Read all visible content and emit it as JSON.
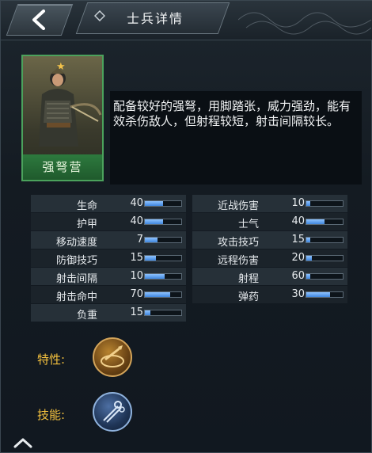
{
  "header": {
    "title": "士兵详情",
    "back_icon": "chevron-left-icon"
  },
  "unit": {
    "name": "强弩营",
    "stars": "★",
    "description": "配备较好的强弩，用脚踏张，威力强劲，能有效杀伤敌人，但射程较短，射击间隔较长。"
  },
  "stats_left": [
    {
      "label": "生命",
      "value": "40",
      "level": 0.5
    },
    {
      "label": "护甲",
      "value": "40",
      "level": 0.5
    },
    {
      "label": "移动速度",
      "value": "7",
      "level": 0.35
    },
    {
      "label": "防御技巧",
      "value": "15",
      "level": 0.3
    },
    {
      "label": "射击间隔",
      "value": "10",
      "level": 0.55
    },
    {
      "label": "射击命中",
      "value": "70",
      "level": 0.7
    },
    {
      "label": "负重",
      "value": "15",
      "level": 0.15
    }
  ],
  "stats_right": [
    {
      "label": "近战伤害",
      "value": "10",
      "level": 0.1
    },
    {
      "label": "士气",
      "value": "40",
      "level": 0.5
    },
    {
      "label": "攻击技巧",
      "value": "15",
      "level": 0.1
    },
    {
      "label": "远程伤害",
      "value": "20",
      "level": 0.15
    },
    {
      "label": "射程",
      "value": "60",
      "level": 0.1
    },
    {
      "label": "弹药",
      "value": "30",
      "level": 0.65
    }
  ],
  "traits": {
    "feature_label": "特性:",
    "skill_label": "技能:"
  },
  "colors": {
    "accent_gold": "#f4c13e",
    "bar_blue": "#3f86de",
    "portrait_green": "#2d7a3e"
  }
}
